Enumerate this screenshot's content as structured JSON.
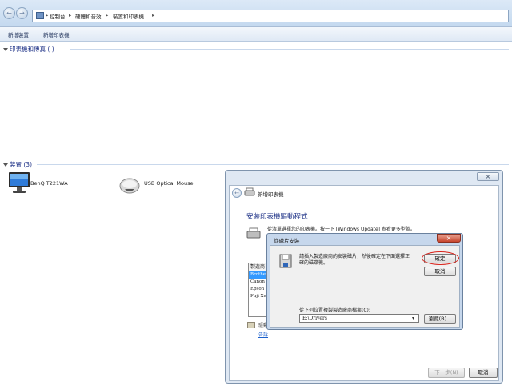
{
  "address_bar": {
    "breadcrumb": [
      "控制台",
      "硬體和音效",
      "裝置和印表機"
    ]
  },
  "toolbar": {
    "add_device": "新增裝置",
    "add_printer": "新增印表機"
  },
  "groups": {
    "printers_heading": "印表機和傳真 (  )",
    "devices_heading": "裝置 (3)"
  },
  "devices": [
    {
      "label": "BenQ T221WA",
      "icon": "monitor-icon"
    },
    {
      "label": "USB Optical Mouse",
      "icon": "mouse-icon"
    }
  ],
  "wizard": {
    "title": "新增印表機",
    "heading": "安裝印表機驅動程式",
    "instruction": "從清單選擇您的印表機。按一下 [Windows Update] 查看更多型號。",
    "manufacturer_header": "製造商",
    "manufacturers": [
      "Brother",
      "Canon",
      "Epson",
      "Fuji Xerox"
    ],
    "signed_partial": "驅動",
    "link_partial": "告訴",
    "next_button": "下一步(N)",
    "cancel_button": "取消"
  },
  "dialog": {
    "title": "從磁片安裝",
    "message": "請插入製造廠商的安裝磁片，然後確定在下面選擇正確的磁碟機。",
    "ok_button": "確定",
    "cancel_button": "取消",
    "copy_label": "從下列位置複製製造廠商檔案(C):",
    "path_value": "E:\\Drivers",
    "browse_button": "瀏覽(B)..."
  },
  "colors": {
    "heading_blue": "#1e3287",
    "highlight_circle": "#d9241c"
  }
}
